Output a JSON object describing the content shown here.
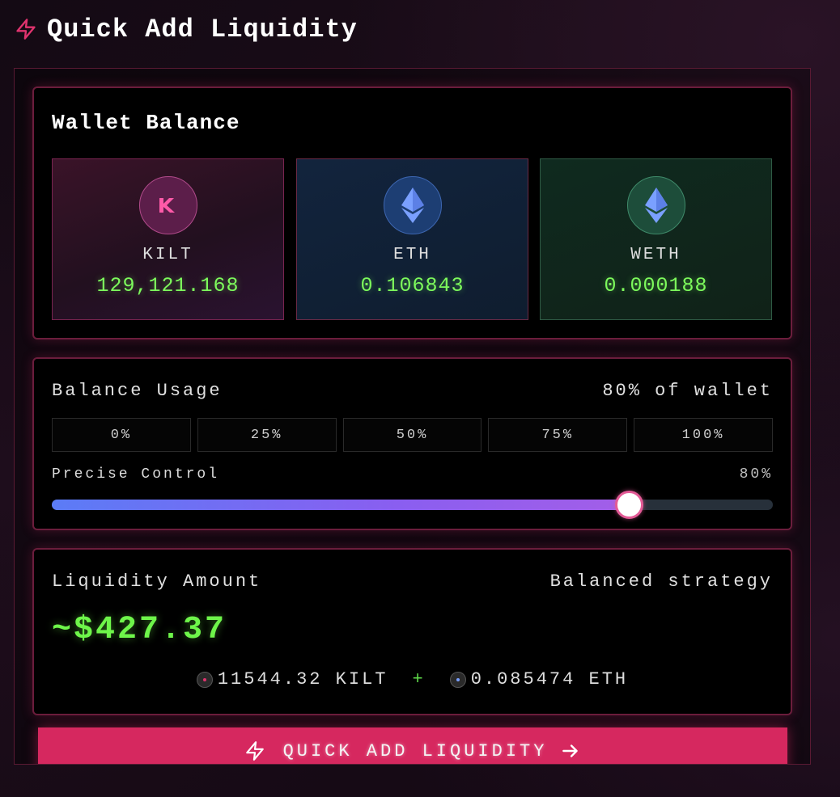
{
  "header": {
    "title": "Quick Add Liquidity",
    "icon": "lightning-icon"
  },
  "wallet": {
    "title": "Wallet Balance",
    "tokens": [
      {
        "symbol": "KILT",
        "amount": "129,121.168",
        "icon": "kilt-logo-icon",
        "accent": "#b04a8a"
      },
      {
        "symbol": "ETH",
        "amount": "0.106843",
        "icon": "ethereum-icon",
        "accent": "#3d66b0"
      },
      {
        "symbol": "WETH",
        "amount": "0.000188",
        "icon": "ethereum-icon",
        "accent": "#3f8a6a"
      }
    ]
  },
  "usage": {
    "title": "Balance Usage",
    "summary": "80% of wallet",
    "presets": [
      "0%",
      "25%",
      "50%",
      "75%",
      "100%"
    ],
    "precise_label": "Precise Control",
    "precise_value": "80%",
    "slider_fraction": 0.8
  },
  "liquidity": {
    "title": "Liquidity Amount",
    "strategy": "Balanced strategy",
    "amount": "~$427.37",
    "kilt_part": "11544.32 KILT",
    "plus": "+",
    "eth_part": "0.085474 ETH"
  },
  "cta": {
    "label": "QUICK ADD LIQUIDITY",
    "icon": "lightning-icon",
    "trailing_icon": "arrow-right-icon"
  },
  "colors": {
    "accent": "#d6285f",
    "value_green": "#7dfa5c"
  }
}
